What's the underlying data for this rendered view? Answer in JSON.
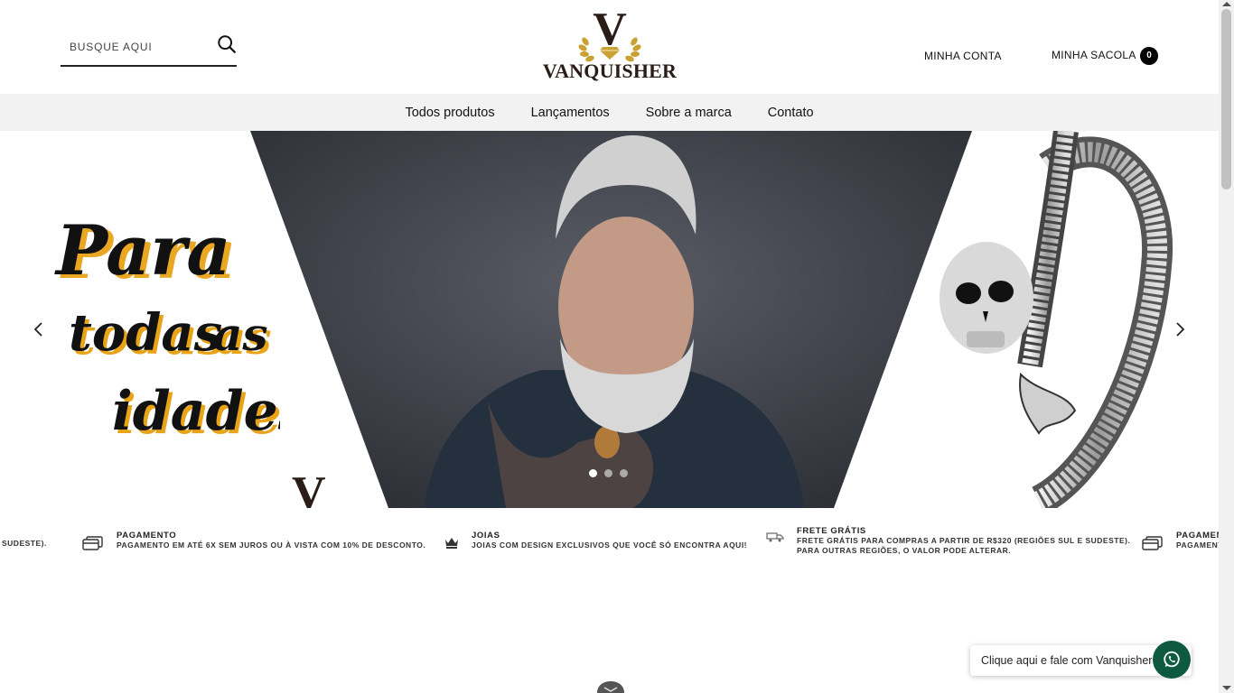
{
  "header": {
    "search_placeholder": "BUSQUE AQUI",
    "logo_letter": "V",
    "logo_text": "VANQUISHER",
    "account_label": "MINHA CONTA",
    "bag_label": "MINHA SACOLA",
    "bag_count": "0"
  },
  "nav": {
    "items": [
      {
        "label": "Todos produtos"
      },
      {
        "label": "Lançamentos"
      },
      {
        "label": "Sobre a marca"
      },
      {
        "label": "Contato"
      }
    ]
  },
  "hero": {
    "headline": [
      "Para",
      "todas",
      "as",
      "idades"
    ],
    "slide_count": 3,
    "active_slide": 1,
    "accent_color": "#e8a317"
  },
  "info_strip": [
    {
      "title": "",
      "desc": "SUDESTE)."
    },
    {
      "title": "PAGAMENTO",
      "desc": "PAGAMENTO EM ATÉ 6X SEM JUROS OU À VISTA COM 10% DE DESCONTO.",
      "icon": "credit-card-icon"
    },
    {
      "title": "JOIAS",
      "desc": "JOIAS COM DESIGN EXCLUSIVOS QUE VOCÊ SÓ ENCONTRA AQUI!",
      "icon": "crown-icon"
    },
    {
      "title": "FRETE GRÁTIS",
      "desc": "FRETE GRÁTIS PARA COMPRAS A PARTIR DE R$320 (REGIÕES SUL E SUDESTE).",
      "desc2": "PARA OUTRAS REGIÕES, O VALOR PODE ALTERAR.",
      "icon": "truck-icon"
    },
    {
      "title": "PAGAMEN",
      "desc": "PAGAMENT",
      "icon": "credit-card-icon"
    }
  ],
  "whatsapp": {
    "label": "Clique aqui e fale com Vanquisher",
    "color": "#0e5a41"
  }
}
